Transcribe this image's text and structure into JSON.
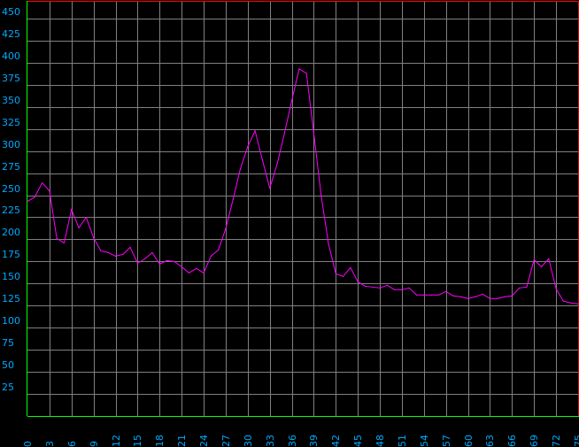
{
  "chart_data": {
    "type": "line",
    "title": "",
    "xlabel": "",
    "ylabel": "",
    "grid": true,
    "xlim": [
      0,
      75
    ],
    "ylim": [
      0,
      470
    ],
    "x_ticks": [
      0,
      3,
      6,
      9,
      12,
      15,
      18,
      21,
      24,
      27,
      30,
      33,
      36,
      39,
      42,
      45,
      48,
      51,
      54,
      57,
      60,
      63,
      66,
      69,
      72,
      75
    ],
    "x_tick_labels": [
      "0",
      "3",
      "6",
      "9",
      "12",
      "15",
      "18",
      "21",
      "24",
      "27",
      "30",
      "33",
      "36",
      "39",
      "42",
      "45",
      "48",
      "51",
      "54",
      "57",
      "60",
      "63",
      "66",
      "69",
      "72",
      "75"
    ],
    "y_ticks": [
      25,
      50,
      75,
      100,
      125,
      150,
      175,
      200,
      225,
      250,
      275,
      300,
      325,
      350,
      375,
      400,
      425,
      450
    ],
    "y_tick_labels": [
      "25",
      "50",
      "75",
      "100",
      "125",
      "150",
      "175",
      "200",
      "225",
      "250",
      "275",
      "300",
      "325",
      "350",
      "375",
      "400",
      "425",
      "450"
    ],
    "series": [
      {
        "color": "#ff00ff",
        "x": [
          0,
          1,
          2,
          3,
          4,
          5,
          6,
          7,
          8,
          9,
          10,
          11,
          12,
          13,
          14,
          15,
          16,
          17,
          18,
          19,
          20,
          21,
          22,
          23,
          24,
          25,
          26,
          27,
          28,
          29,
          30,
          31,
          32,
          33,
          34,
          35,
          36,
          37,
          38,
          39,
          40,
          41,
          42,
          43,
          44,
          45,
          46,
          47,
          48,
          49,
          50,
          51,
          52,
          53,
          54,
          55,
          56,
          57,
          58,
          59,
          60,
          61,
          62,
          63,
          64,
          65,
          66,
          67,
          68,
          69,
          70,
          71,
          72,
          73,
          74,
          75
        ],
        "values": [
          243,
          248,
          264,
          255,
          201,
          196,
          234,
          213,
          225,
          202,
          187,
          185,
          181,
          183,
          191,
          173,
          178,
          185,
          172,
          176,
          175,
          169,
          162,
          167,
          162,
          181,
          188,
          212,
          245,
          280,
          305,
          323,
          290,
          258,
          285,
          320,
          357,
          393,
          388,
          320,
          250,
          195,
          161,
          158,
          168,
          152,
          147,
          146,
          145,
          148,
          143,
          143,
          145,
          137,
          137,
          137,
          137,
          141,
          136,
          135,
          133,
          135,
          138,
          133,
          133,
          135,
          136,
          145,
          146,
          177,
          169,
          178,
          144,
          130,
          128,
          127
        ]
      }
    ]
  },
  "colors": {
    "background": "#000000",
    "grid": "#808080",
    "top_border": "#ff0000",
    "right_border": "#ff0000",
    "baseline": "#00ff00",
    "left_axis": "#00ff00",
    "tick_label": "#00aaff"
  }
}
